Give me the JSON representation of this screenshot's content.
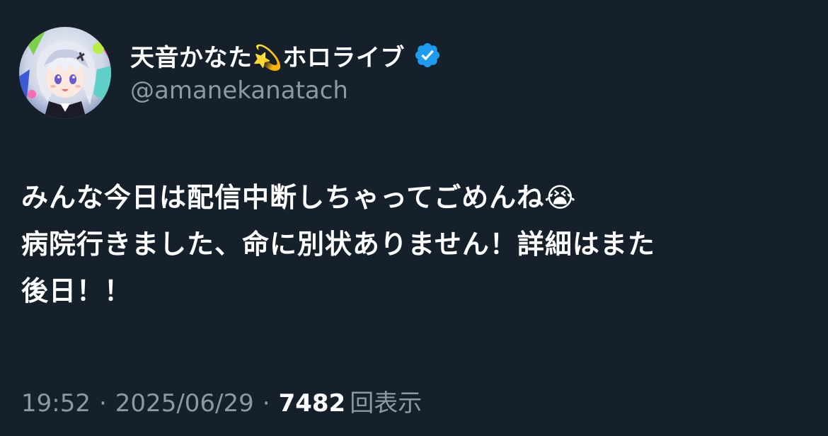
{
  "author": {
    "display_name": "天音かなた💫ホロライブ",
    "handle": "@amanekanatach",
    "verified": true
  },
  "tweet": {
    "lines": [
      "みんな今日は配信中断しちゃってごめんね😭",
      "病院行きました、命に別状ありません！詳細はまた",
      "後日！！"
    ]
  },
  "meta": {
    "time": "19:52",
    "separator": "·",
    "date": "2025/06/29",
    "views_count": "7482",
    "views_label": "回表示"
  },
  "colors": {
    "background": "#15202b",
    "primary_text": "#ffffff",
    "secondary_text": "#8b98a5",
    "verified_badge": "#1d9bf0"
  },
  "icons": {
    "verified": "verified-badge-icon",
    "avatar": "avatar-image"
  }
}
